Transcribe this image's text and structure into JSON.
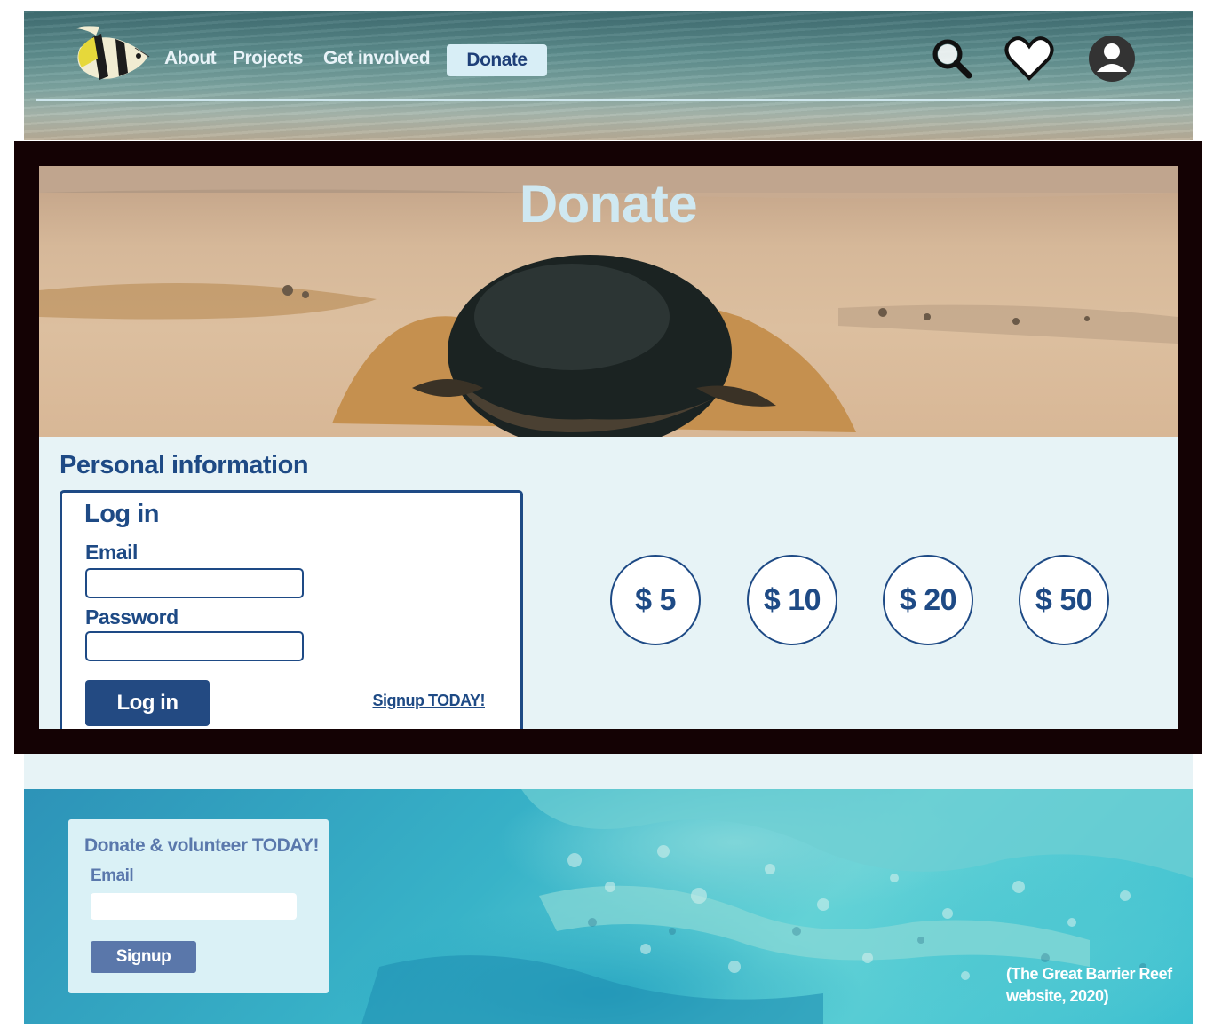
{
  "nav": {
    "links": [
      {
        "label": "About"
      },
      {
        "label": "Projects"
      },
      {
        "label": "Get involved"
      }
    ],
    "donate_label": "Donate",
    "icons": {
      "search": "search-icon",
      "favorites": "heart-icon",
      "account": "user-icon",
      "logo": "fish-logo"
    }
  },
  "hero": {
    "title": "Donate"
  },
  "personal_info": {
    "heading": "Personal information",
    "login": {
      "title": "Log in",
      "email_label": "Email",
      "email_value": "",
      "password_label": "Password",
      "password_value": "",
      "button_label": "Log in",
      "signup_link": "Signup TODAY!"
    }
  },
  "amounts": [
    {
      "label": "$ 5"
    },
    {
      "label": "$ 10"
    },
    {
      "label": "$ 20"
    },
    {
      "label": "$ 50"
    }
  ],
  "footer": {
    "form_title": "Donate & volunteer TODAY!",
    "email_label": "Email",
    "email_value": "",
    "signup_label": "Signup",
    "credit": "(The Great Barrier Reef website, 2020)"
  },
  "colors": {
    "primary": "#1e4a85",
    "frame": "#140204",
    "panel": "#e7f3f6",
    "nav_donate_bg": "#d8eef6",
    "footer_button": "#5a77aa"
  }
}
